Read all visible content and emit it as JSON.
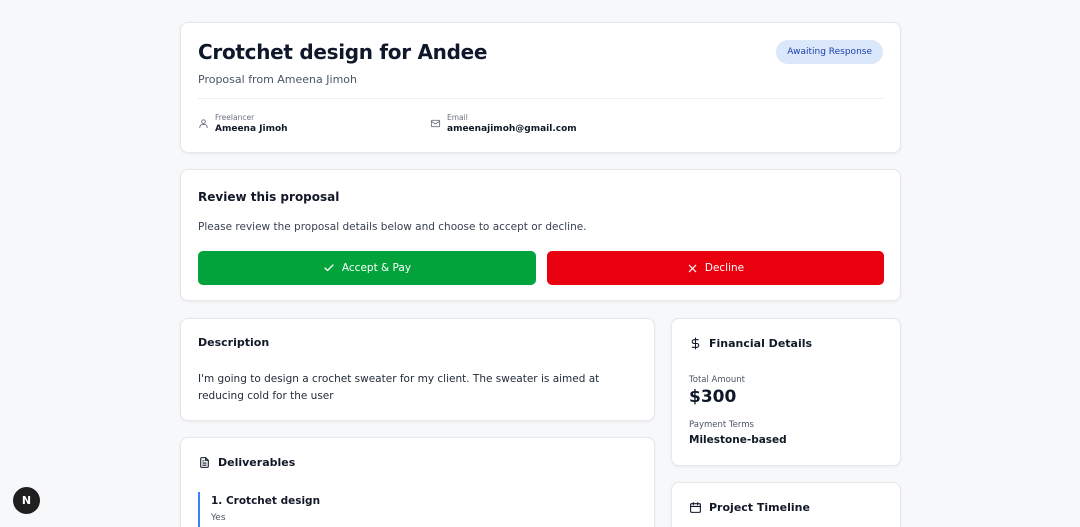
{
  "header": {
    "title": "Crotchet design for Andee",
    "subtitle": "Proposal from Ameena Jimoh",
    "status": "Awaiting Response",
    "freelancer_label": "Freelancer",
    "freelancer_value": "Ameena Jimoh",
    "email_label": "Email",
    "email_value": "ameenajimoh@gmail.com"
  },
  "review": {
    "title": "Review this proposal",
    "text": "Please review the proposal details below and choose to accept or decline.",
    "accept_label": "Accept & Pay",
    "decline_label": "Decline"
  },
  "description": {
    "title": "Description",
    "text": "I'm going to design a crochet sweater for my client. The sweater is aimed at reducing cold for the user"
  },
  "deliverables": {
    "title": "Deliverables",
    "items": [
      {
        "name": "1. Crotchet design",
        "meta": "Yes"
      }
    ]
  },
  "financial": {
    "title": "Financial Details",
    "total_label": "Total Amount",
    "total_value": "$300",
    "terms_label": "Payment Terms",
    "terms_value": "Milestone-based"
  },
  "timeline": {
    "title": "Project Timeline"
  },
  "dev_badge": "N",
  "colors": {
    "accept": "#03a33c",
    "decline": "#e8000e",
    "badge_bg": "#dbe8fb",
    "badge_text": "#1e40af",
    "accent_border": "#3b82f6"
  },
  "icons": [
    "user-icon",
    "mail-icon",
    "check-icon",
    "x-icon",
    "file-text-icon",
    "dollar-icon",
    "calendar-icon"
  ]
}
